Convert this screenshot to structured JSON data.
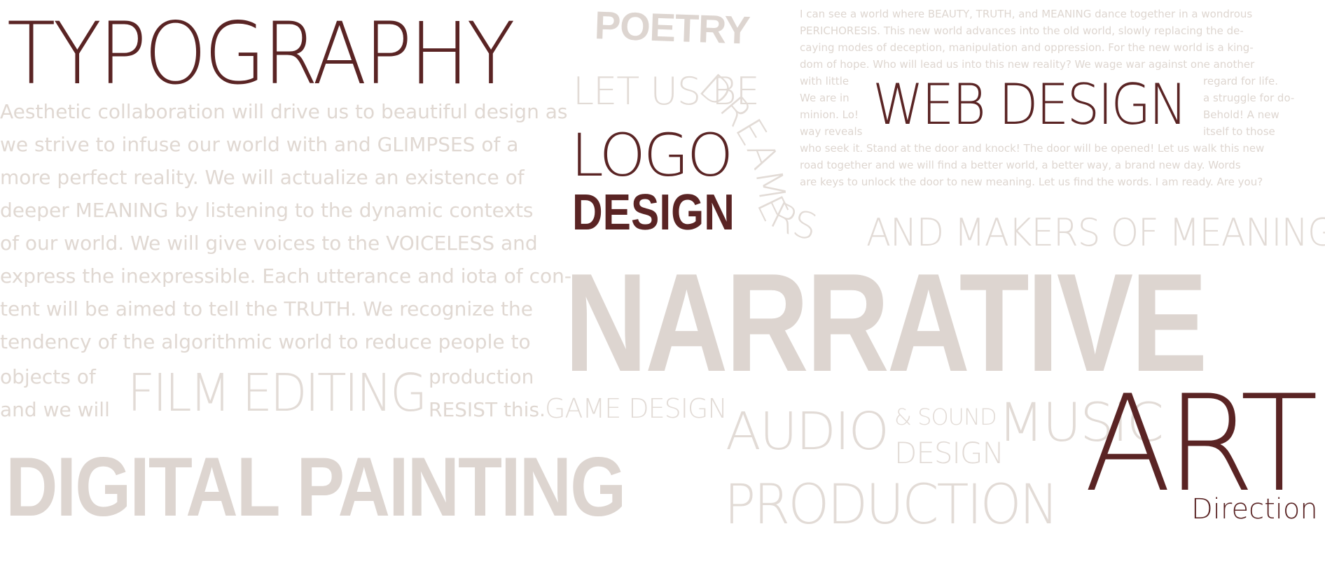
{
  "words": {
    "typography": "TYPOGRAPHY",
    "poetry": "POETRY",
    "let_us_be": "LET US BE",
    "dreamers": "DREAMERS",
    "and_makers": "AND MAKERS OF MEANING",
    "logo": "LOGO",
    "design_stamp": "DESIGN",
    "web_design": "WEB DESIGN",
    "narrative": "NARRATIVE",
    "film_editing": "FILM EDITING",
    "game_design": "GAME DESIGN",
    "audio": "AUDIO",
    "sound_and": "& SOUND",
    "sound_design": "DESIGN",
    "music": "MUSIC",
    "art": "ART",
    "direction": "Direction",
    "production": "PRODUCTION",
    "digital_painting": "DIGITAL PAINTING"
  },
  "left_paragraph": {
    "lines": [
      "Aesthetic collaboration will drive us to beautiful design as",
      "we strive to infuse our world with and GLIMPSES of a",
      "more perfect reality. We will actualize an existence of",
      "deeper MEANING by listening to the dynamic contexts",
      "of our world. We will give voices to the VOICELESS and",
      "express the inexpressible. Each utterance and iota of con-",
      "tent will be aimed to tell the TRUTH. We recognize the",
      "tendency of the algorithmic world to reduce people to"
    ],
    "objects_of": "objects of",
    "and_we_will": "and we will",
    "production": "production",
    "resist_this": "RESIST this."
  },
  "right_paragraph": {
    "lines_top": [
      "I can see a world where BEAUTY, TRUTH, and MEANING dance together in a wondrous",
      "PERICHORESIS. This new world advances into the old world, slowly replacing the de-",
      "caying modes of deception, manipulation and oppression. For the new world is a king-",
      "dom of hope. Who will lead us into this new reality? We wage war against one another"
    ],
    "left_fragments": [
      "with little",
      "We are in",
      "minion. Lo!",
      "way reveals"
    ],
    "right_fragments": [
      "regard for life.",
      "a struggle for do-",
      "Behold! A new",
      "itself to those"
    ],
    "lines_bottom": [
      "who seek it. Stand at the door and knock! The door will be opened! Let us walk this new",
      "road together and we will find a better world, a better way, a brand new day. Words",
      "are keys to unlock the door to new meaning. Let us find the words. I am ready. Are you?"
    ]
  },
  "colors": {
    "dark": "#5a2424",
    "light": "#e2dbd6"
  }
}
